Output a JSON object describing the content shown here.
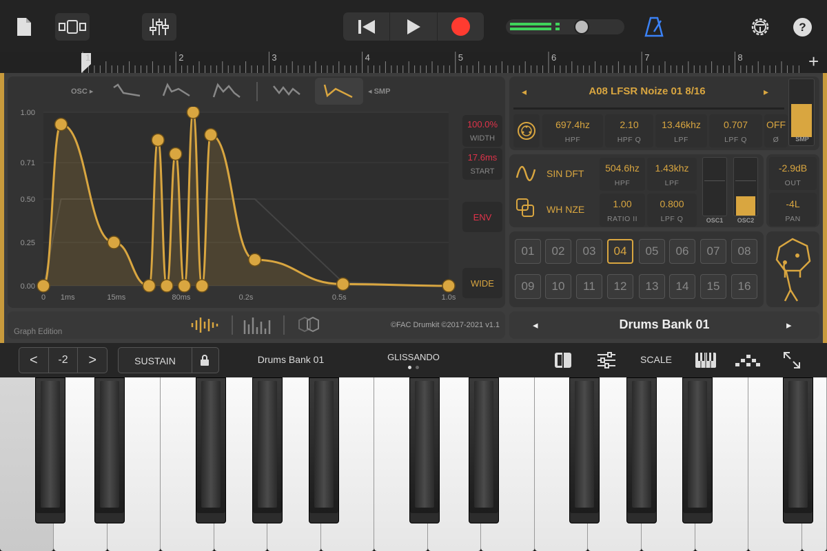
{
  "toolbar": {
    "icons": [
      "document-icon",
      "tracks-view-icon",
      "mixer-icon",
      "rewind-icon",
      "play-icon",
      "record-icon",
      "metronome-icon",
      "settings-icon",
      "help-icon"
    ],
    "help_label": "?",
    "record_color": "#ff3b30",
    "metronome_color": "#3b82f6",
    "volume_level": 0.66
  },
  "ruler": {
    "marks": [
      "1",
      "2",
      "3",
      "4",
      "5",
      "6",
      "7",
      "8"
    ],
    "add_label": "+"
  },
  "graph": {
    "osc_label": "OSC ▸",
    "smp_label": "◂ SMP",
    "y_ticks": [
      "1.00",
      "0.71",
      "0.50",
      "0.25",
      "0.00"
    ],
    "x_ticks": [
      "0",
      "1ms",
      "15ms",
      "80ms",
      "0.2s",
      "0.5s",
      "1.0s"
    ],
    "width_value": "100.0%",
    "width_label": "WIDTH",
    "start_value": "17.6ms",
    "start_label": "START",
    "env_label": "ENV",
    "wide_label": "WIDE",
    "footer_left": "Graph Edition",
    "copyright": "©FAC Drumkit ©2017-2021 v1.1",
    "points": [
      [
        0,
        0
      ],
      [
        1,
        0.93
      ],
      [
        4,
        0.25
      ],
      [
        6,
        0
      ],
      [
        6.5,
        0.84
      ],
      [
        7,
        0
      ],
      [
        7.5,
        0.76
      ],
      [
        8,
        0
      ],
      [
        8.5,
        1.0
      ],
      [
        9,
        0
      ],
      [
        9.5,
        0.87
      ],
      [
        12,
        0.15
      ],
      [
        17,
        0.01
      ],
      [
        23,
        0
      ]
    ]
  },
  "sample": {
    "name": "A08 LFSR Noize 01 8/16",
    "prev": "◂",
    "next": "▸",
    "smp_label": "SMP",
    "smp_level": 0.6,
    "params": [
      {
        "value": "697.4hz",
        "label": "HPF"
      },
      {
        "value": "2.10",
        "label": "HPF Q"
      },
      {
        "value": "13.46khz",
        "label": "LPF"
      },
      {
        "value": "0.707",
        "label": "LPF Q"
      },
      {
        "value": "OFF",
        "label": "Ø"
      }
    ]
  },
  "osc": {
    "osc1_name": "SIN DFT",
    "osc1_hpf": "504.6hz",
    "osc1_hpf_label": "HPF",
    "osc1_lpf": "1.43khz",
    "osc1_lpf_label": "LPF",
    "osc2_name": "WH NZE",
    "ratio": "1.00",
    "ratio_label": "RATIO II",
    "lpfq": "0.800",
    "lpfq_label": "LPF Q",
    "osc1_label": "OSC1",
    "osc2_label": "OSC2",
    "osc1_level": 0,
    "osc2_level": 0.34
  },
  "output": {
    "out_value": "-2.9dB",
    "out_label": "OUT",
    "pan_value": "-4L",
    "pan_label": "PAN"
  },
  "pads": [
    "01",
    "02",
    "03",
    "04",
    "05",
    "06",
    "07",
    "08",
    "09",
    "10",
    "11",
    "12",
    "13",
    "14",
    "15",
    "16"
  ],
  "selected_pad": "04",
  "bank": {
    "name": "Drums Bank 01",
    "prev": "◂",
    "next": "▸"
  },
  "kbbar": {
    "prev": "<",
    "octave": "-2",
    "next": ">",
    "sustain": "SUSTAIN",
    "bank": "Drums Bank 01",
    "mode": "GLISSANDO",
    "scale": "SCALE"
  },
  "accent": "#d9a640"
}
